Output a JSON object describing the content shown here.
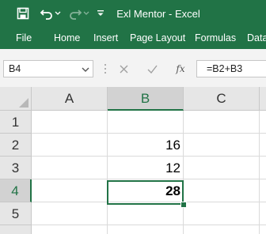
{
  "app": {
    "title": "Exl Mentor  -  Excel",
    "accent_color": "#217346"
  },
  "quick_access": {
    "icons": [
      "save-icon",
      "undo-icon",
      "undo-dropdown-icon",
      "redo-icon",
      "redo-dropdown-icon",
      "customize-qat-icon"
    ]
  },
  "ribbon": {
    "tabs": [
      "File",
      "Home",
      "Insert",
      "Page Layout",
      "Formulas",
      "Data"
    ]
  },
  "formula_bar": {
    "name_box": "B4",
    "cancel_icon": "cancel-icon",
    "enter_icon": "enter-icon",
    "function_label": "fx",
    "formula": "=B2+B3"
  },
  "grid": {
    "columns": [
      "A",
      "B",
      "C"
    ],
    "rows": [
      "1",
      "2",
      "3",
      "4",
      "5"
    ],
    "selected_column": "B",
    "selected_row": "4",
    "cells": {
      "B2": "16",
      "B3": "12",
      "B4": "28"
    }
  }
}
